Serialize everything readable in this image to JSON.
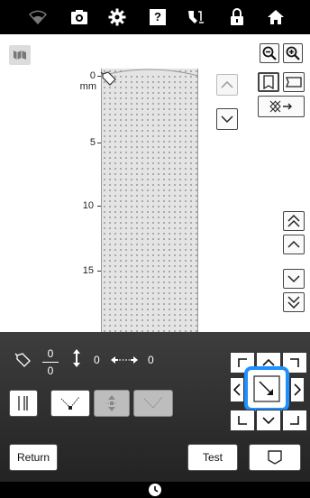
{
  "topbar": {
    "icons": [
      "wifi-icon",
      "camera-icon",
      "gear-icon",
      "help-icon",
      "needle-icon",
      "lock-icon",
      "home-icon"
    ],
    "help_glyph": "?"
  },
  "ruler": {
    "unit": "mm",
    "labels": [
      "0",
      "5",
      "10",
      "15"
    ]
  },
  "panel": {
    "width_num": "0",
    "width_den": "0",
    "length_value": "0",
    "spacing_value": "0"
  },
  "buttons": {
    "return_label": "Return",
    "test_label": "Test"
  },
  "colors": {
    "accent": "#1e90ff",
    "panel_bg": "#2f2f2f",
    "fabric": "#e4e4e4"
  }
}
